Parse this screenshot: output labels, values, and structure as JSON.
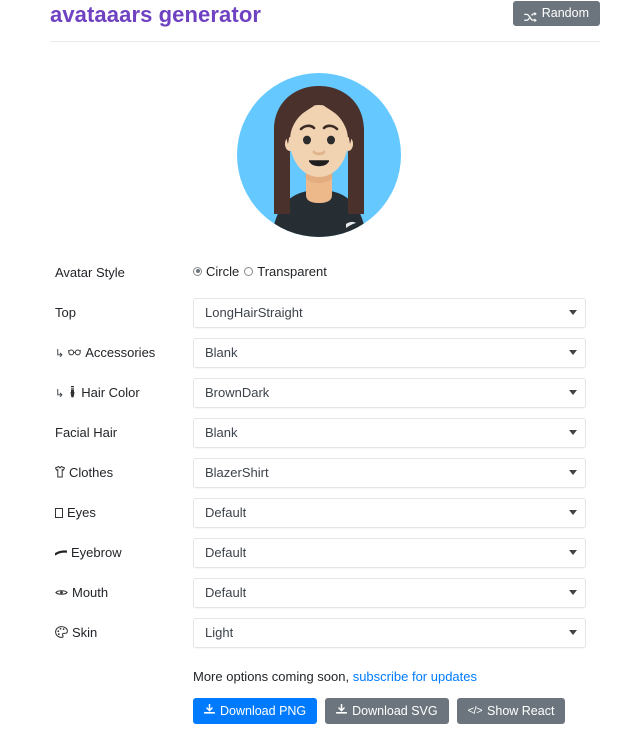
{
  "header": {
    "title": "avataaars generator",
    "random_button": {
      "label": "Random",
      "icon": "shuffle-icon"
    }
  },
  "avatar": {
    "style": "Circle",
    "background_color": "#65C9FF",
    "skin_color": "#F8D4B0",
    "hair_color": "#4A312C",
    "clothes_color": "#262E33",
    "mouth_color": "#1F1F1F",
    "eye_color": "#2C2C2C"
  },
  "form": {
    "rows": [
      {
        "label": "Avatar Style",
        "icon": null,
        "nested": false,
        "control": "radio",
        "options": [
          {
            "label": "Circle",
            "selected": true
          },
          {
            "label": "Transparent",
            "selected": false
          }
        ]
      },
      {
        "label": "Top",
        "icon": null,
        "nested": false,
        "control": "select",
        "value": "LongHairStraight"
      },
      {
        "label": "Accessories",
        "icon": "glasses-icon",
        "nested": true,
        "control": "select",
        "value": "Blank"
      },
      {
        "label": "Hair Color",
        "icon": "paint-brush-icon",
        "nested": true,
        "control": "select",
        "value": "BrownDark"
      },
      {
        "label": "Facial Hair",
        "icon": null,
        "nested": false,
        "control": "select",
        "value": "Blank"
      },
      {
        "label": "Clothes",
        "icon": "tshirt-icon",
        "nested": false,
        "control": "select",
        "value": "BlazerShirt"
      },
      {
        "label": "Eyes",
        "icon": "box-glyph-icon",
        "nested": false,
        "control": "select",
        "value": "Default"
      },
      {
        "label": "Eyebrow",
        "icon": "eyebrow-dash-icon",
        "nested": false,
        "control": "select",
        "value": "Default"
      },
      {
        "label": "Mouth",
        "icon": "mouth-icon",
        "nested": false,
        "control": "select",
        "value": "Default"
      },
      {
        "label": "Skin",
        "icon": "palette-icon",
        "nested": false,
        "control": "select",
        "value": "Light"
      }
    ]
  },
  "footer": {
    "note_text": "More options coming soon, ",
    "link_text": "subscribe for updates",
    "buttons": [
      {
        "label": "Download PNG",
        "icon": "download-icon",
        "variant": "primary"
      },
      {
        "label": "Download SVG",
        "icon": "download-icon",
        "variant": "secondary"
      },
      {
        "label": "Show React",
        "icon": "code-icon",
        "variant": "secondary"
      }
    ]
  }
}
